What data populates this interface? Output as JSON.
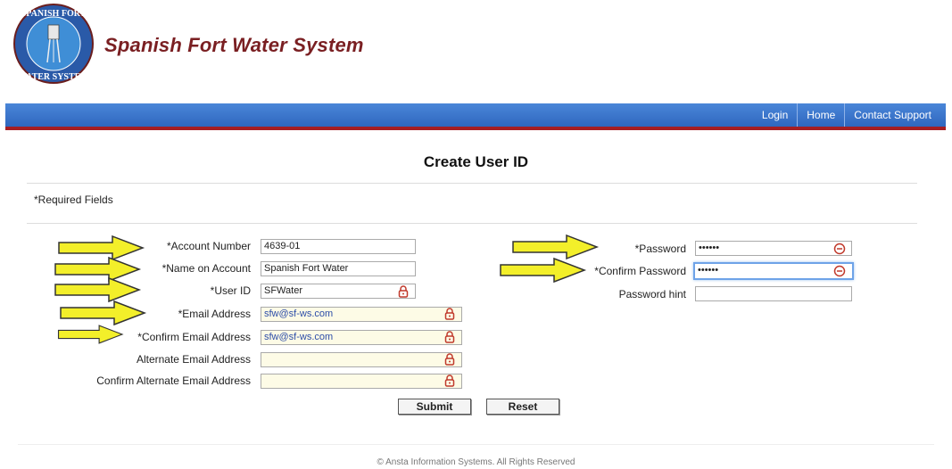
{
  "header": {
    "logo_text_top": "SPANISH FORT",
    "logo_text_bottom": "WATER SYSTEM",
    "site_title": "Spanish Fort Water System"
  },
  "nav": {
    "items": [
      "Login",
      "Home",
      "Contact Support"
    ]
  },
  "page": {
    "title": "Create User ID",
    "required_note": "*Required Fields"
  },
  "form": {
    "left": [
      {
        "label": "*Account Number",
        "value": "4639-01"
      },
      {
        "label": "*Name on Account",
        "value": "Spanish Fort Water"
      },
      {
        "label": "*User ID",
        "value": "SFWater"
      },
      {
        "label": "*Email Address",
        "value": "sfw@sf-ws.com"
      },
      {
        "label": "*Confirm Email Address",
        "value": "sfw@sf-ws.com"
      },
      {
        "label": "Alternate Email Address",
        "value": ""
      },
      {
        "label": "Confirm Alternate Email Address",
        "value": ""
      }
    ],
    "right": [
      {
        "label": "*Password",
        "value": "••••••"
      },
      {
        "label": "*Confirm Password",
        "value": "••••••"
      },
      {
        "label": "Password hint",
        "value": ""
      }
    ],
    "submit_label": "Submit",
    "reset_label": "Reset"
  },
  "footer": {
    "text": "© Ansta Information Systems. All Rights Reserved"
  },
  "colors": {
    "nav_blue": "#3b74cc",
    "nav_border": "#a61e22",
    "title_red": "#7a1f22",
    "arrow_yellow": "#f3ef2a"
  },
  "icons": {
    "lock": "lock-icon",
    "annotation_arrow": "yellow-arrow-icon"
  }
}
